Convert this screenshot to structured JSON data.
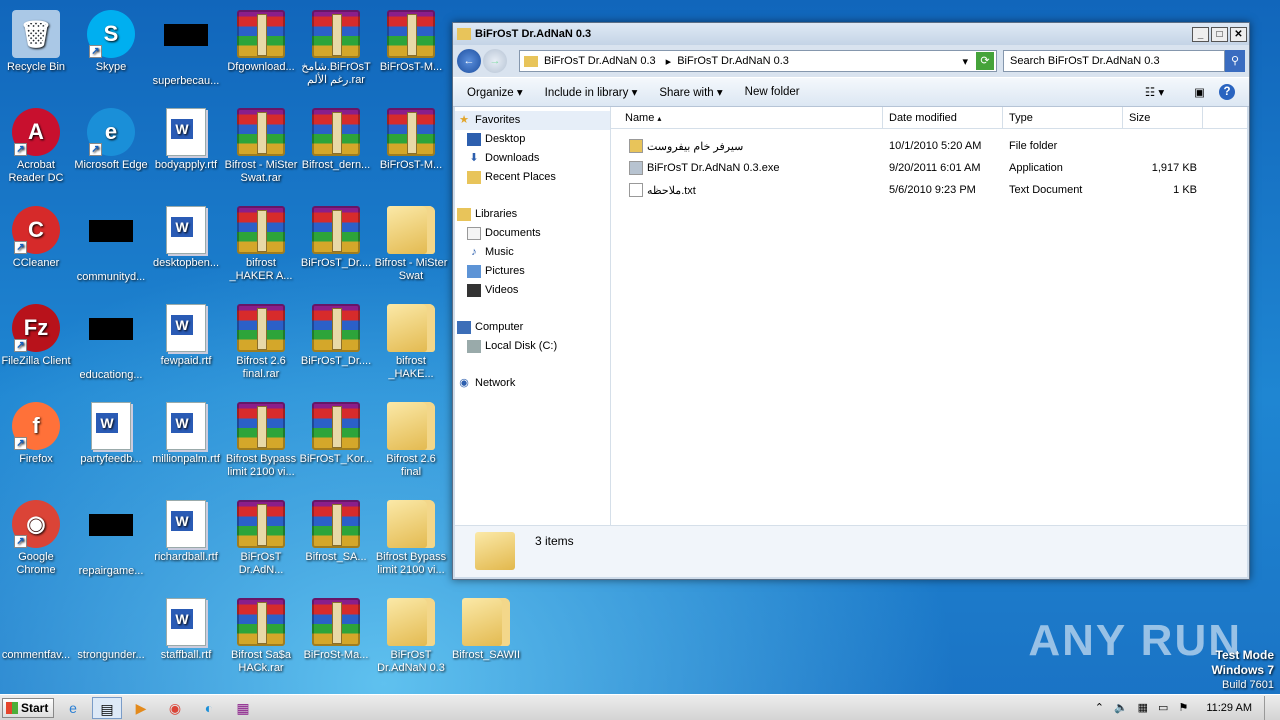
{
  "desktop_icons": [
    {
      "label": "Recycle Bin",
      "type": "bin",
      "x": 0,
      "y": 0
    },
    {
      "label": "Skype",
      "type": "skype",
      "x": 1,
      "y": 0
    },
    {
      "label": "superbecau...",
      "type": "blank",
      "x": 2,
      "y": 0
    },
    {
      "label": "Dfgownload...",
      "type": "rar",
      "x": 3,
      "y": 0
    },
    {
      "label": "شامخ.BiFrOsT\nرغم الألم.rar",
      "type": "rar",
      "x": 4,
      "y": 0
    },
    {
      "label": "BiFrOsT-M...",
      "type": "rar",
      "x": 5,
      "y": 0
    },
    {
      "label": "Acrobat\nReader DC",
      "type": "acrobat",
      "x": 0,
      "y": 1
    },
    {
      "label": "Microsoft Edge",
      "type": "edge",
      "x": 1,
      "y": 1
    },
    {
      "label": "bodyapply.rtf",
      "type": "doc",
      "x": 2,
      "y": 1
    },
    {
      "label": "Bifrost - MiSter\nSwat.rar",
      "type": "rar",
      "x": 3,
      "y": 1
    },
    {
      "label": "Bifrost_dern...",
      "type": "rar",
      "x": 4,
      "y": 1
    },
    {
      "label": "BiFrOsT-M...",
      "type": "rar",
      "x": 5,
      "y": 1
    },
    {
      "label": "CCleaner",
      "type": "ccleaner",
      "x": 0,
      "y": 2
    },
    {
      "label": "communityd...",
      "type": "blank",
      "x": 1,
      "y": 2
    },
    {
      "label": "desktopben...",
      "type": "doc",
      "x": 2,
      "y": 2
    },
    {
      "label": "bifrost\n_HAKER A...",
      "type": "rar",
      "x": 3,
      "y": 2
    },
    {
      "label": "BiFrOsT_Dr....",
      "type": "rar",
      "x": 4,
      "y": 2
    },
    {
      "label": "Bifrost - MiSter\nSwat",
      "type": "folder",
      "x": 5,
      "y": 2
    },
    {
      "label": "FileZilla Client",
      "type": "filezilla",
      "x": 0,
      "y": 3
    },
    {
      "label": "educationg...",
      "type": "blank",
      "x": 1,
      "y": 3
    },
    {
      "label": "fewpaid.rtf",
      "type": "doc",
      "x": 2,
      "y": 3
    },
    {
      "label": "Bifrost 2.6\nfinal.rar",
      "type": "rar",
      "x": 3,
      "y": 3
    },
    {
      "label": "BiFrOsT_Dr....",
      "type": "rar",
      "x": 4,
      "y": 3
    },
    {
      "label": "bifrost\n_HAKE...",
      "type": "folder",
      "x": 5,
      "y": 3
    },
    {
      "label": "Firefox",
      "type": "firefox",
      "x": 0,
      "y": 4
    },
    {
      "label": "partyfeedb...",
      "type": "doc",
      "x": 1,
      "y": 4
    },
    {
      "label": "millionpalm.rtf",
      "type": "doc",
      "x": 2,
      "y": 4
    },
    {
      "label": "Bifrost Bypass\nlimit 2100 vi...",
      "type": "rar",
      "x": 3,
      "y": 4
    },
    {
      "label": "BiFrOsT_Kor...",
      "type": "rar",
      "x": 4,
      "y": 4
    },
    {
      "label": "Bifrost 2.6\nfinal",
      "type": "folder",
      "x": 5,
      "y": 4
    },
    {
      "label": "Google\nChrome",
      "type": "chrome",
      "x": 0,
      "y": 5
    },
    {
      "label": "repairgame...",
      "type": "blank",
      "x": 1,
      "y": 5
    },
    {
      "label": "richardball.rtf",
      "type": "doc",
      "x": 2,
      "y": 5
    },
    {
      "label": "BiFrOsT\nDr.AdN...",
      "type": "rar",
      "x": 3,
      "y": 5
    },
    {
      "label": "Bifrost_SA...",
      "type": "rar",
      "x": 4,
      "y": 5
    },
    {
      "label": "Bifrost Bypass\nlimit 2100 vi...",
      "type": "folder",
      "x": 5,
      "y": 5
    },
    {
      "label": "commentfav...",
      "type": "none",
      "x": 0,
      "y": 6
    },
    {
      "label": "strongunder...",
      "type": "none",
      "x": 1,
      "y": 6
    },
    {
      "label": "staffball.rtf",
      "type": "doc",
      "x": 2,
      "y": 6
    },
    {
      "label": "Bifrost Sa$a\nHACk.rar",
      "type": "rar",
      "x": 3,
      "y": 6
    },
    {
      "label": "BiFroSt-Ma...",
      "type": "rar",
      "x": 4,
      "y": 6
    },
    {
      "label": "BiFrOsT\nDr.AdNaN 0.3",
      "type": "folder",
      "x": 5,
      "y": 6
    },
    {
      "label": "Bifrost_SAWII",
      "type": "folder",
      "x": 6,
      "y": 6
    }
  ],
  "window": {
    "title": "BiFrOsT Dr.AdNaN 0.3",
    "breadcrumb": [
      "BiFrOsT Dr.AdNaN 0.3",
      "BiFrOsT Dr.AdNaN 0.3"
    ],
    "search_placeholder": "Search BiFrOsT Dr.AdNaN 0.3",
    "commands": {
      "organize": "Organize",
      "include": "Include in library",
      "share": "Share with",
      "new_folder": "New folder"
    },
    "nav": {
      "favorites": "Favorites",
      "desktop": "Desktop",
      "downloads": "Downloads",
      "recent": "Recent Places",
      "libraries": "Libraries",
      "documents": "Documents",
      "music": "Music",
      "pictures": "Pictures",
      "videos": "Videos",
      "computer": "Computer",
      "local_disk": "Local Disk (C:)",
      "network": "Network"
    },
    "columns": {
      "name": "Name",
      "date": "Date modified",
      "type": "Type",
      "size": "Size"
    },
    "files": [
      {
        "name": "سيرفر خام بيفروست",
        "date": "10/1/2010 5:20 AM",
        "type": "File folder",
        "size": ""
      },
      {
        "name": "BiFrOsT Dr.AdNaN 0.3.exe",
        "date": "9/20/2011 6:01 AM",
        "type": "Application",
        "size": "1,917 KB"
      },
      {
        "name": "ملاحظه.txt",
        "date": "5/6/2010 9:23 PM",
        "type": "Text Document",
        "size": "1 KB"
      }
    ],
    "status": "3 items"
  },
  "taskbar": {
    "start": "Start",
    "clock": "11:29 AM"
  },
  "watermark": {
    "brand": "ANY RUN",
    "mode": "Test Mode",
    "os": "Windows 7",
    "build": "Build 7601"
  }
}
